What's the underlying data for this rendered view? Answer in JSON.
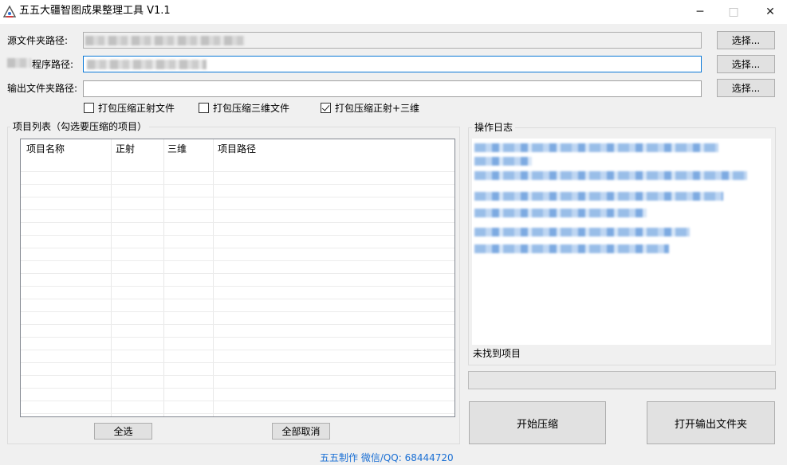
{
  "window": {
    "title": "五五大疆智图成果整理工具    V1.1",
    "icon": "app-logo-icon",
    "controls": {
      "minimize": "─",
      "maximize": "□",
      "close": "✕"
    }
  },
  "paths": {
    "source_label": "源文件夹路径:",
    "program_label": "程序路径:",
    "output_label": "输出文件夹路径:",
    "browse_label": "选择..."
  },
  "options": [
    {
      "label": "打包压缩正射文件",
      "checked": false
    },
    {
      "label": "打包压缩三维文件",
      "checked": false
    },
    {
      "label": "打包压缩正射+三维",
      "checked": true
    }
  ],
  "project_group": {
    "title": "项目列表（勾选要压缩的项目）",
    "columns": [
      "项目名称",
      "正射",
      "三维",
      "项目路径"
    ],
    "select_all": "全选",
    "deselect_all": "全部取消"
  },
  "log_group": {
    "title": "操作日志",
    "status": "未找到项目"
  },
  "actions": {
    "start": "开始压缩",
    "open_output": "打开输出文件夹"
  },
  "footer": "五五制作 微信/QQ: 68444720",
  "colors": {
    "accent": "#0a78d7",
    "footer": "#1a6fd4"
  }
}
